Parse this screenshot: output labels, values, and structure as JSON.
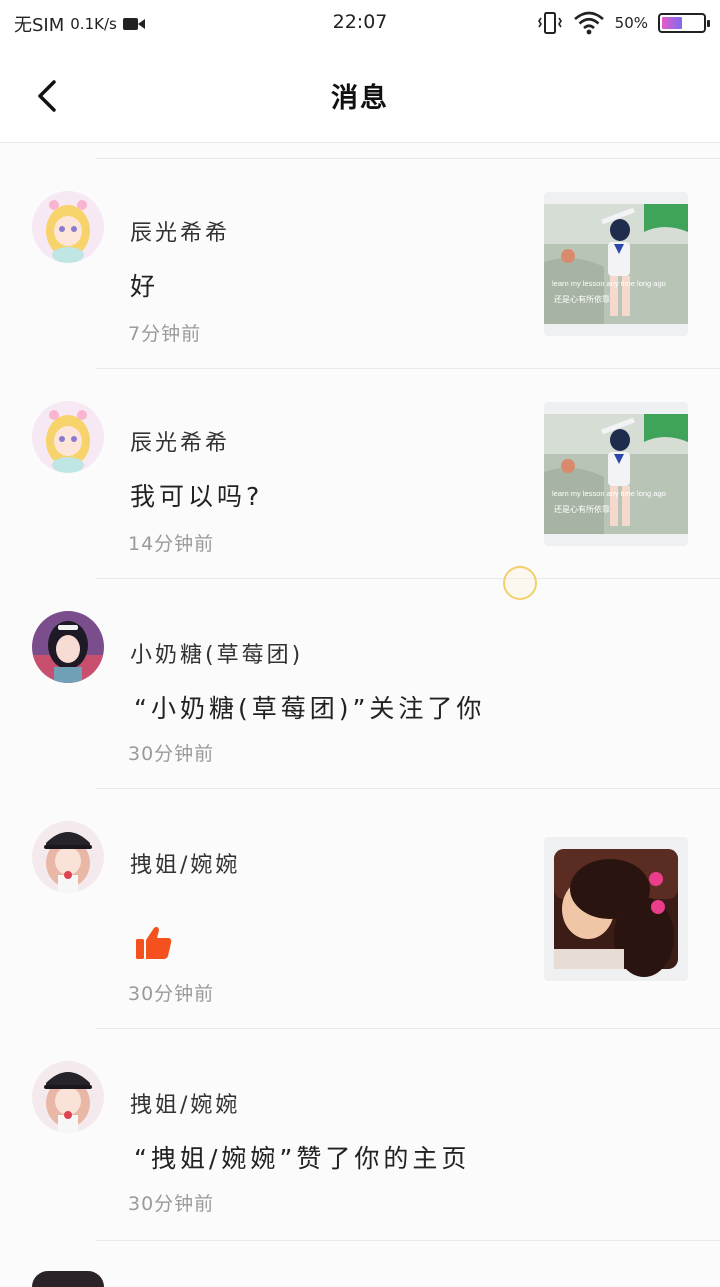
{
  "status_bar": {
    "carrier": "无SIM",
    "speed": "0.1K/s",
    "time": "22:07",
    "battery": "50%",
    "battery_level": 0.5
  },
  "header": {
    "title": "消息",
    "back_icon": "chevron-left-icon"
  },
  "messages": [
    {
      "name": "辰光希希",
      "text": "好",
      "time": "7分钟前",
      "thumb_caption_1": "learn my lesson any time long ago",
      "thumb_caption_2": "还是心有所依靠",
      "avatar": "anime-avatar-blonde"
    },
    {
      "name": "辰光希希",
      "text": "我可以吗?",
      "time": "14分钟前",
      "thumb_caption_1": "learn my lesson any time long ago",
      "thumb_caption_2": "还是心有所依靠",
      "avatar": "anime-avatar-blonde"
    },
    {
      "name": "小奶糖(草莓团)",
      "text": "“小奶糖(草莓团)”关注了你",
      "time": "30分钟前",
      "avatar": "anime-avatar-dark-hair"
    },
    {
      "name": "拽姐/婉婉",
      "text": "",
      "time": "30分钟前",
      "avatar": "anime-avatar-cap",
      "icon": "thumbs-up-icon"
    },
    {
      "name": "拽姐/婉婉",
      "text": "“拽姐/婉婉”赞了你的主页",
      "time": "30分钟前",
      "avatar": "anime-avatar-cap"
    }
  ],
  "colors": {
    "like": "#f4511e",
    "divider": "#e8e8ec",
    "time_text": "#9a9a9a"
  }
}
